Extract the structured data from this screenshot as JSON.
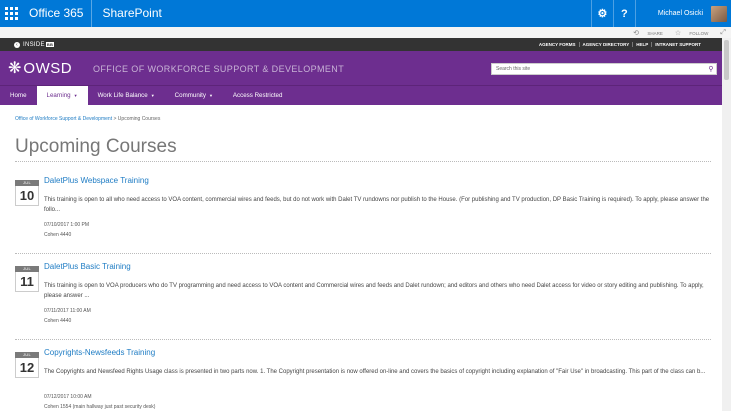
{
  "suite": {
    "app_name": "Office 365",
    "site_app": "SharePoint",
    "user_name": "Michael Osicki",
    "help_label": "?"
  },
  "sharebar": {
    "share_label": "SHARE",
    "follow_label": "FOLLOW"
  },
  "inside": {
    "logo_text": "INSIDE",
    "logo_badge": "BB",
    "links": [
      "AGENCY FORMS",
      "AGENCY DIRECTORY",
      "HELP",
      "INTRANET SUPPORT"
    ]
  },
  "header": {
    "logo_text": "OWSD",
    "site_title": "OFFICE OF WORKFORCE SUPPORT & DEVELOPMENT",
    "search_placeholder": "Search this site"
  },
  "nav": {
    "items": [
      {
        "label": "Home"
      },
      {
        "label": "Learning"
      },
      {
        "label": "Work Life Balance"
      },
      {
        "label": "Community"
      },
      {
        "label": "Access Restricted"
      }
    ]
  },
  "breadcrumb": {
    "parent": "Office of Workforce Support & Development",
    "separator": ">",
    "current": "Upcoming Courses"
  },
  "page_title": "Upcoming Courses",
  "courses": [
    {
      "month": "JUL",
      "day": "10",
      "title": "DaletPlus Webspace Training",
      "description": "This training is open to all who need access to VOA content, commercial wires and feeds, but do not work with Dalet TV rundowns nor publish to the House. (For publishing and TV production, DP Basic Training is required). To apply, please answer the follo...",
      "datetime": "07/10/2017 1:00 PM",
      "location": "Cohen 4440"
    },
    {
      "month": "JUL",
      "day": "11",
      "title": "DaletPlus Basic Training",
      "description": "This training is open to VOA producers who do TV programming and need access to VOA content and Commercial wires and feeds and Dalet rundown; and editors and others who need Dalet access for video or story editing and publishing. To apply, please answer ...",
      "datetime": "07/11/2017 11:00 AM",
      "location": "Cohen 4440"
    },
    {
      "month": "JUL",
      "day": "12",
      "title": "Copyrights-Newsfeeds Training",
      "description": "The Copyrights and Newsfeed Rights Usage class is presented in two parts now. 1. The Copyright presentation is now offered on-line and covers the basics of copyright including explanation of \"Fair Use\" in broadcasting. This part of the class can b...",
      "datetime": "07/12/2017 10:00 AM",
      "location": "Cohen 1554 (main hallway just past security desk)"
    }
  ],
  "colors": {
    "suite_blue": "#0078d7",
    "brand_purple": "#6d2e8f",
    "link_blue": "#1e7cc4"
  }
}
